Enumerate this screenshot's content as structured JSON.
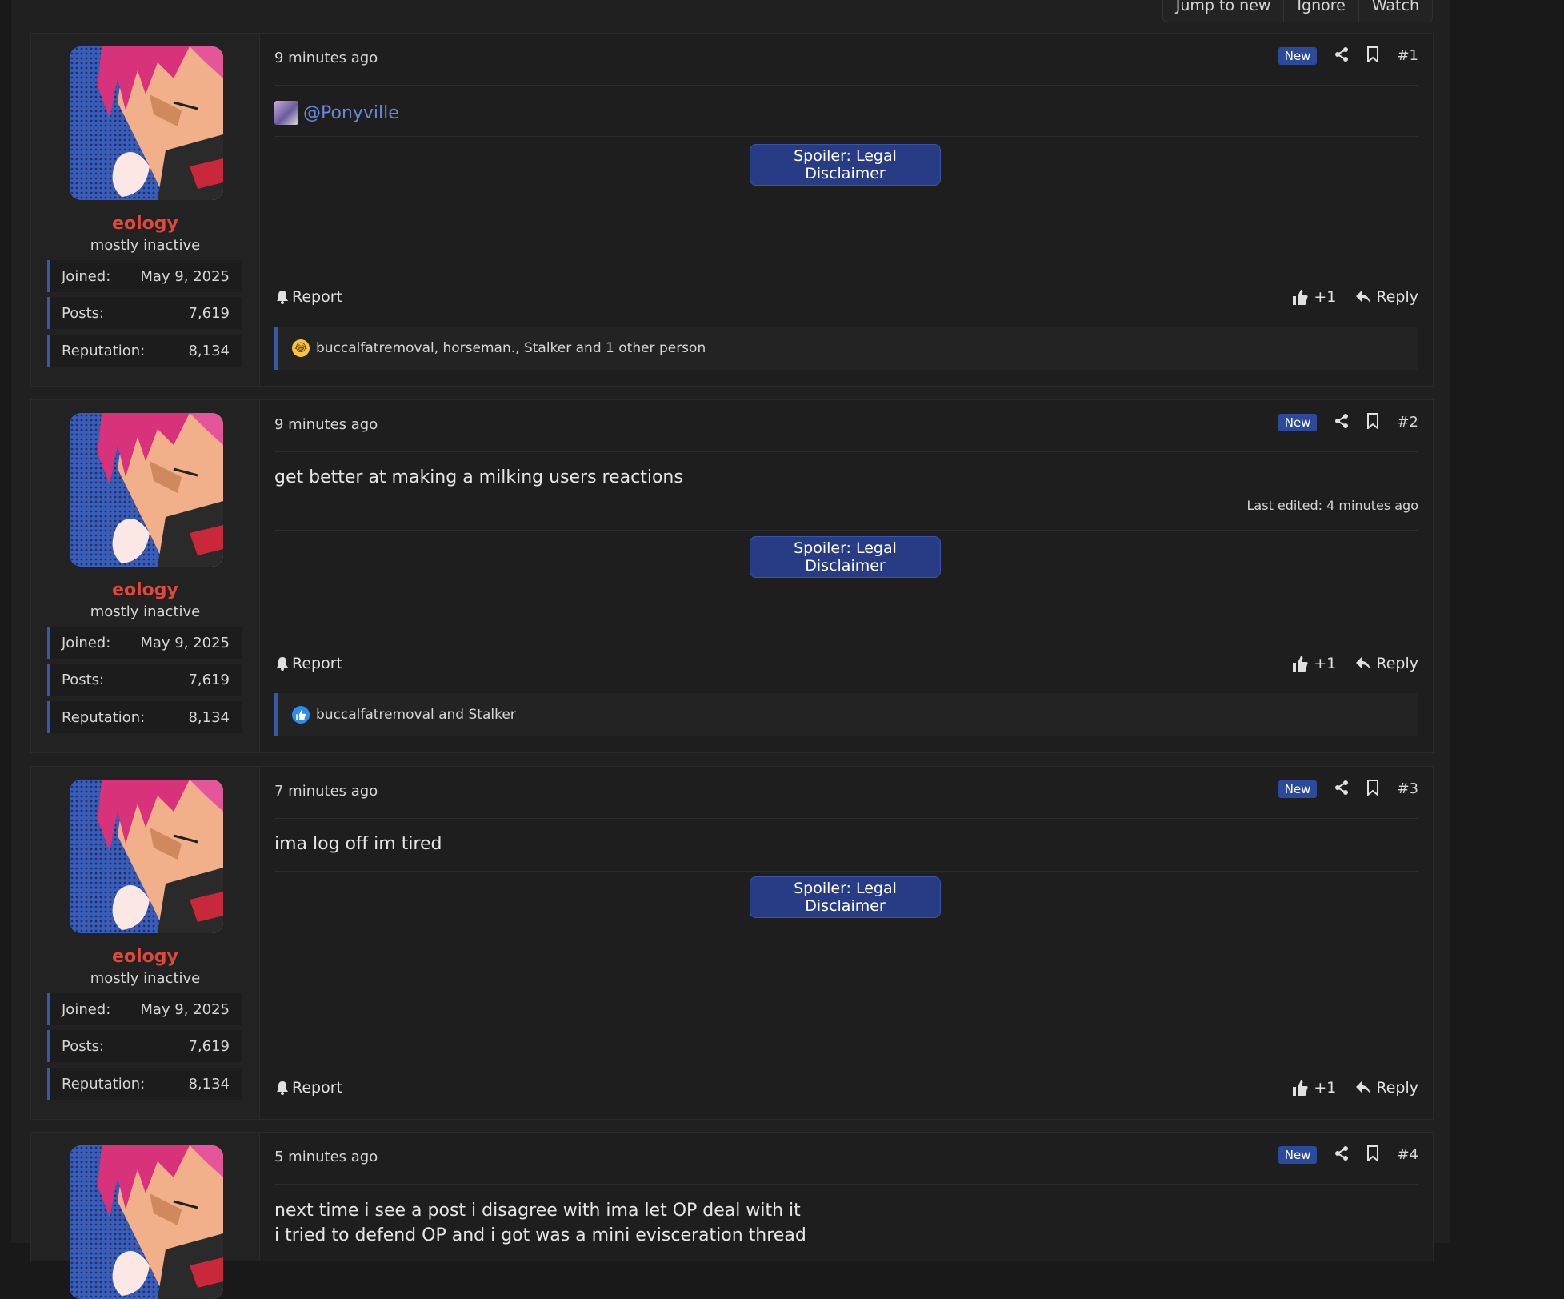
{
  "topbar": {
    "buttons": [
      "Jump to new",
      "Ignore",
      "Watch"
    ]
  },
  "posts": [
    {
      "time": "9 minutes ago",
      "badge": "New",
      "number": "#1",
      "author": {
        "name": "eology",
        "title": "mostly inactive",
        "joined_label": "Joined:",
        "joined": "May 9, 2025",
        "posts_label": "Posts:",
        "posts": "7,619",
        "rep_label": "Reputation:",
        "rep": "8,134"
      },
      "mention": "@Ponyville",
      "spoiler": "Spoiler: Legal Disclaimer",
      "report": "Report",
      "react_count": "+1",
      "reply": "Reply",
      "reactions": "buccalfatremoval, horseman., Stalker and 1 other person",
      "reaction_icon": "laughing-emoji-icon"
    },
    {
      "time": "9 minutes ago",
      "badge": "New",
      "number": "#2",
      "author": {
        "name": "eology",
        "title": "mostly inactive",
        "joined_label": "Joined:",
        "joined": "May 9, 2025",
        "posts_label": "Posts:",
        "posts": "7,619",
        "rep_label": "Reputation:",
        "rep": "8,134"
      },
      "text": "get better at making a milking users reactions",
      "edited": "Last edited: 4 minutes ago",
      "spoiler": "Spoiler: Legal Disclaimer",
      "report": "Report",
      "react_count": "+1",
      "reply": "Reply",
      "reactions": "buccalfatremoval and Stalker",
      "reaction_icon": "like-emoji-icon"
    },
    {
      "time": "7 minutes ago",
      "badge": "New",
      "number": "#3",
      "author": {
        "name": "eology",
        "title": "mostly inactive",
        "joined_label": "Joined:",
        "joined": "May 9, 2025",
        "posts_label": "Posts:",
        "posts": "7,619",
        "rep_label": "Reputation:",
        "rep": "8,134"
      },
      "text": "ima log off im tired",
      "spoiler": "Spoiler: Legal Disclaimer",
      "report": "Report",
      "react_count": "+1",
      "reply": "Reply"
    },
    {
      "time": "5 minutes ago",
      "badge": "New",
      "number": "#4",
      "text_line1": "next time i see a post i disagree with ima let OP deal with it",
      "text_line2": "i tried to defend OP and i got was a mini evisceration thread"
    }
  ],
  "colors": {
    "accent": "#2b4a9c",
    "username": "#e0483c",
    "background": "#202020",
    "mention": "#6a86d8"
  }
}
